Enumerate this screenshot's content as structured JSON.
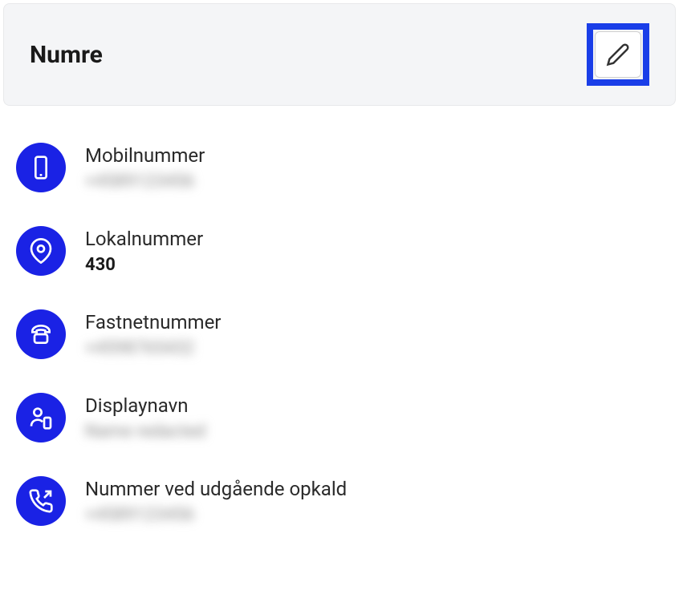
{
  "header": {
    "title": "Numre"
  },
  "items": [
    {
      "icon": "mobile",
      "label": "Mobilnummer",
      "value": "+4589123456",
      "blurred": true
    },
    {
      "icon": "pin",
      "label": "Lokalnummer",
      "value": "430",
      "blurred": false
    },
    {
      "icon": "landline",
      "label": "Fastnetnummer",
      "value": "+4598765432",
      "blurred": true
    },
    {
      "icon": "person-phone",
      "label": "Displaynavn",
      "value": "Name redacted",
      "blurred": true
    },
    {
      "icon": "outgoing-call",
      "label": "Nummer ved udgående opkald",
      "value": "+4589123456",
      "blurred": true
    }
  ]
}
